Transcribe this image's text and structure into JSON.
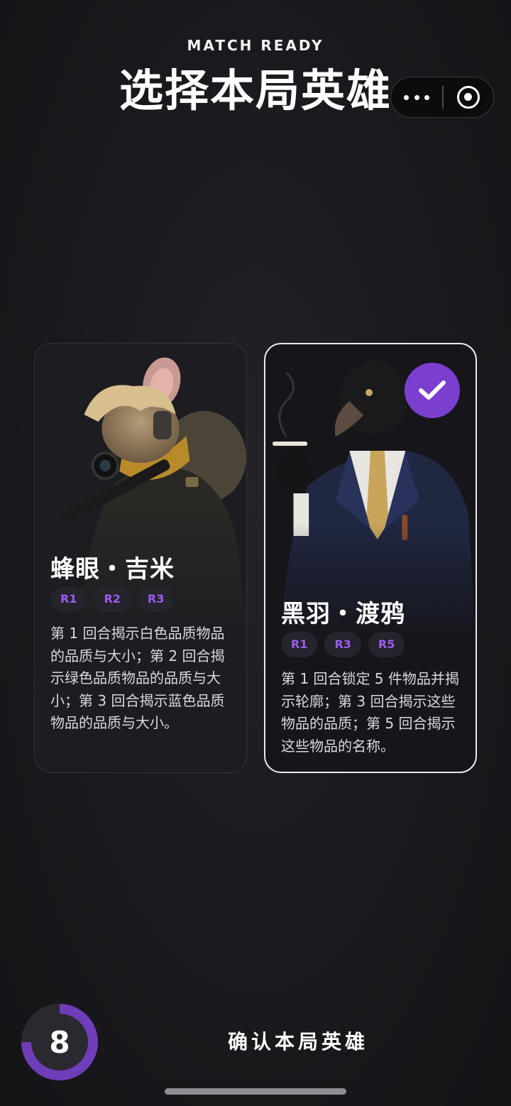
{
  "header": {
    "eyebrow": "MATCH READY",
    "title": "选择本局英雄"
  },
  "capsule": {
    "more_icon": "more-dots-icon",
    "close_icon": "target-close-icon"
  },
  "heroes": [
    {
      "name": "蜂眼・吉米",
      "rounds": [
        "R1",
        "R2",
        "R3"
      ],
      "description": "第 1 回合揭示白色品质物品的品质与大小；第 2 回合揭示绿色品质物品的品质与大小；第 3 回合揭示蓝色品质物品的品质与大小。",
      "selected": false,
      "portrait": "sniper-mouse-portrait"
    },
    {
      "name": "黑羽・渡鸦",
      "rounds": [
        "R1",
        "R3",
        "R5"
      ],
      "description": "第 1 回合锁定 5 件物品并揭示轮廓；第 3 回合揭示这些物品的品质；第 5 回合揭示这些物品的名称。",
      "selected": true,
      "portrait": "raven-suit-portrait"
    }
  ],
  "footer": {
    "countdown": "8",
    "confirm_label": "确认本局英雄"
  },
  "colors": {
    "accent": "#7b3fd0",
    "tag_text": "#9b5cf0",
    "background": "#18171b"
  }
}
